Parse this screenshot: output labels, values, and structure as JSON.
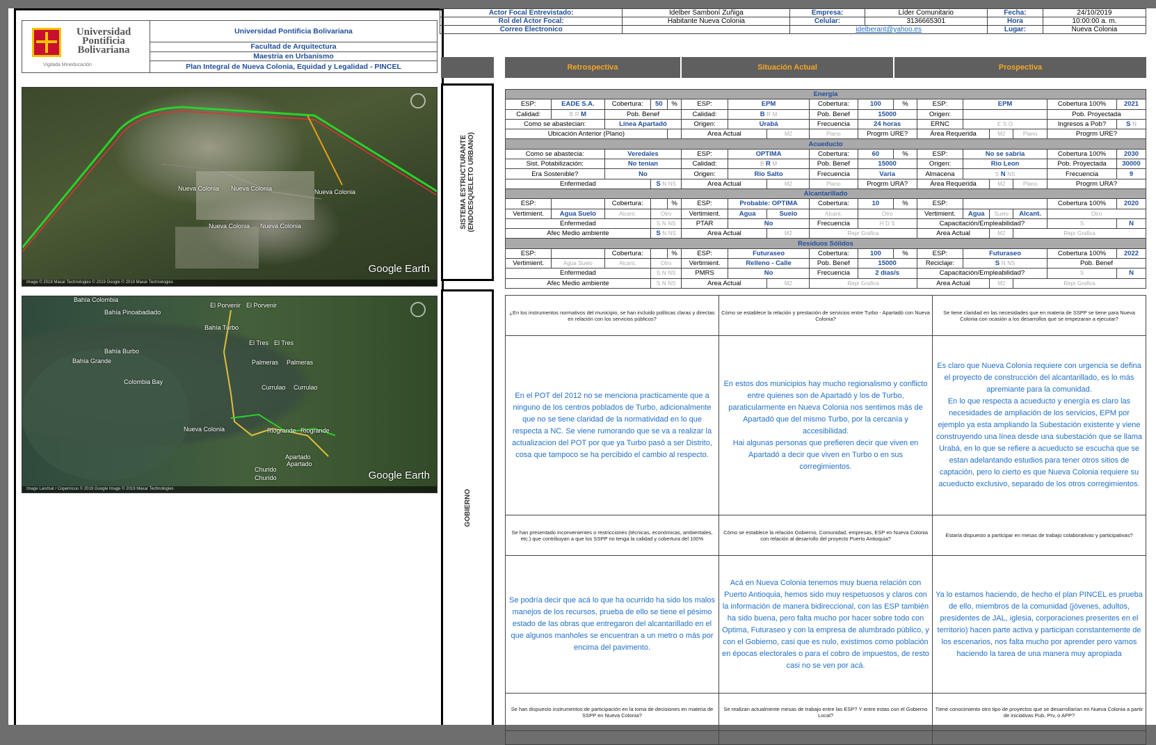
{
  "university": {
    "name": "Universidad Pontificia Bolivariana",
    "logo_text": "Universidad Pontificia Bolivariana",
    "motto": "Vigilada Mineducación",
    "faculty": "Facultad de Arquitectura",
    "program": "Maestría en Urbanismo",
    "plan": "Plan Integral de Nueva Colonia, Equidad y Legalidad - PINCEL"
  },
  "map1": {
    "labels": [
      "Nueva Colonia",
      "Nueva Colonia",
      "Nueva Colonia",
      "Nueva Colonia",
      "Nueva Colonia"
    ],
    "brand": "Google Earth",
    "footer": "Image © 2019 Maxar Technologies  © 2019 Google  © 2019 Maxar Technologies"
  },
  "map2": {
    "labels": [
      "Bahía Colombia",
      "Bahía Pinoabadiado",
      "El Porvenir",
      "El Porvenir",
      "Bahía Turbo",
      "El Tres",
      "El Tres",
      "Bahía Burbo",
      "Bahía Grande",
      "Palmeras",
      "Palmeras",
      "Colombia Bay",
      "Currulao",
      "Currulao",
      "Nueva Colonia",
      "Riogrande",
      "Riogrande",
      "Apartado",
      "Apartado",
      "Churido",
      "Churido"
    ],
    "brand": "Google Earth",
    "footer": "Image Landsat / Copernicus  © 2019 Google  Image © 2019 Maxar Technologies"
  },
  "info": {
    "actor_label": "Actor Focal Entrevistado:",
    "actor": "Idelber Samboní Zuñiga",
    "empresa_label": "Empresa:",
    "empresa": "Líder Comunitario",
    "fecha_label": "Fecha:",
    "fecha": "24/10/2019",
    "rol_label": "Rol del Actor Focal:",
    "rol": "Habitante Nueva Colonia",
    "celular_label": "Celular:",
    "celular": "3136665301",
    "hora_label": "Hora",
    "hora": "10:00:00 a. m.",
    "correo_label": "Correo Electronico",
    "correo": "idelberant@yahoo.es",
    "lugar_label": "Lugar:",
    "lugar": "Nueva Colonia"
  },
  "columns": {
    "retro": "Retrospectiva",
    "actual": "Situación Actual",
    "prosp": "Prospectiva"
  },
  "sides": {
    "sistema": "SISTEMA ESTRUCTURANTE\n(ENDOESQUELETO URBANO)",
    "gobierno": "GOBIERNO"
  },
  "grid": {
    "energia": "Energía",
    "acueducto": "Acueducto",
    "alcantarillado": "Alcantarillado",
    "residuos": "Residuos Sólidos",
    "esp": "ESP:",
    "cobertura": "Cobertura:",
    "pct": "%",
    "calidad": "Calidad:",
    "pob_benef": "Pob. Benef",
    "origen": "Origen:",
    "pob_proy": "Pob. Proyectada",
    "frecuencia": "Frecuencia",
    "area_actual": "Area Actual",
    "area_req": "Área Requerida",
    "m2": "M2",
    "plano": "Plano",
    "repr": "Repr Grafica",
    "progrm_ure": "Progrm URE?",
    "progrm_ura": "Progrm URA?",
    "enfermedad": "Enfermedad",
    "afec": "Afec Medio ambiente",
    "vertim": "Vertimient.",
    "agua": "Agua",
    "suelo": "Suelo",
    "alcant": "Alcant.",
    "otro": "Otro",
    "s": "S",
    "n": "N",
    "ns": "NS",
    "b": "B",
    "r": "R",
    "m": "M",
    "h": "H",
    "d": "D",
    "e1": {
      "esp": "EADE S.A.",
      "cob": "50",
      "como": "Como se abastecian:",
      "como_val": "Línea Apartadó",
      "ubic": "Ubicación Anterior (Plano)",
      "esp2": "EPM",
      "cob2": "100",
      "origen2": "Urabá",
      "pob2": "15000",
      "frec2": "24 horas",
      "esp3": "EPM",
      "cob3": "Cobertura 100%",
      "year3": "2021",
      "ernc": "ERNC",
      "e": "E",
      "o": "O",
      "ingresos": "Ingresos a Pob?"
    },
    "a1": {
      "como": "Como se abastecia:",
      "como_val": "Veredales",
      "sist": "Sist. Potabilización:",
      "sist_val": "No tenian",
      "sost": "Era Sostenible?",
      "sost_val": "No",
      "esp2": "OPTIMA",
      "cob2": "60",
      "origen2": "Rio Salto",
      "pob2": "15000",
      "frec2": "Varia",
      "esp3": "No se sabria",
      "cob3": "Cobertura 100%",
      "year3": "2030",
      "origen3": "Rio Leon",
      "pob3": "30000",
      "almacena": "Almacena",
      "frec3": "9"
    },
    "al1": {
      "esp2": "Probable: OPTIMA",
      "cob2": "10",
      "ptar": "PTAR",
      "ptar_val": "No",
      "cob3": "Cobertura 100%",
      "year3": "2020",
      "capac": "Capacitación/Empleabilidad?"
    },
    "r1": {
      "esp2": "Futuraseo",
      "cob2": "100",
      "relleno": "Relleno - Calle",
      "pob2": "15000",
      "pmrs": "PMRS",
      "pmrs_val": "No",
      "frec2": "2 días/s",
      "esp3": "Futuraseo",
      "cob3": "Cobertura 100%",
      "year3": "2022",
      "reciclaje": "Reciclaje:"
    }
  },
  "gobierno": {
    "q1": [
      "¿En los instrumentos normativos del municipio, se han incluido políticas claras y directas en relación con los servicios públicos?",
      "Cómo se establece la relación y prestación de servicios entre Turbo - Apartadó con Nueva Colonia?",
      "Se tiene claridad en las necesidades que en materia de SSPP se tiene para Nueva Colonia con ocasión a los desarrollos que se empezaran a ejecutar?"
    ],
    "a1": [
      "En el POT del 2012 no se menciona practicamente que a ninguno de los centros poblados de Turbo, adicionalmente que no se tiene claridad de la normatividad en lo que respecta a NC. Se viene rumorando que se va a realizar la actualizacion del POT por que ya Turbo pasó a ser Distrito, cosa que tampoco se ha percibido el cambio al respecto.",
      "En estos dos municipios hay mucho regionalismo y conflicto entre quienes son de Apartadó y los de Turbo, paraticularmente en Nueva Colonia nos sentimos más de Apartadó que del mismo Turbo, por la cercanía y accesibilidad.\nHai algunas personas que prefieren decir que viven en Apartadó a decir que viven en Turbo o en sus corregimientos.",
      "Es claro que Nueva Colonia requiere con urgencia se defina el proyecto de construcción del alcantarillado, es lo más apremiante para la comunidad.\nEn lo que respecta a acueducto y energía es claro las necesidades de ampliación de los servicios, EPM por ejemplo ya esta ampliando la Subestación existente y viene construyendo una línea desde una subestación que se llama Urabá, en lo que se refiere a acueducto se escucha que se estan adelantando estudios para tener otros sitios de captación, pero lo cierto es que Nueva Colonia requiere su acueducto exclusivo, separado de los otros corregimientos."
    ],
    "q2": [
      "Se han presentado inconvenientes o restricciones (técnicas, económicas, ambientales, etc.) que contribuyan a que los SSPP no tenga la calidad y cobertura del 100%",
      "Cómo se establece la relación Gobierno, Comunidad, empresas, ESP en Nueva Colonia con relación al desarrollo del proyecto Puerto Antioquia?",
      "Estaría dispuesto a participar en mesas de trabajo colaborativas y participativas?"
    ],
    "a2": [
      "Se podría decir que acá lo que ha ocurrido ha sido los malos manejos de los recursos, prueba de ello se tiene el pésimo estado de las obras que entregaron del alcantarillado en el que algunos manholes se encuentran a un metro o más por encima del pavimento.",
      "Acá en Nueva Colonia tenemos muy buena relación con Puerto Antioquia, hemos sido muy respetuosos y claros con la información de manera bidireccional, con las ESP también ha sido buena, pero falta mucho por hacer sobre todo con Optima, Futuraseo y con la empresa de alumbrado público, y con el Gobierno, casi que es nulo, existimos como población en épocas electorales o para el cobro de impuestos, de resto casi no se ven por acá.",
      "Ya lo estamos haciendo, de hecho el plan PINCEL es prueba de ello, miembros de la comunidad (jóvenes, adultos, presidentes de JAL, iglesia, corporaciones presentes en el territorio) hacen parte activa y participan constantemente de los escenarios, nos falta mucho por aprender pero vamos haciendo la tarea de una manera muy apropiada"
    ],
    "q3": [
      "Se han dispuesto instrumentos de participación en la toma de decisiones en materia de SSPP en Nueva Colonia?",
      "Se realizan actualmente mesas de trabajo entre las ESP? Y entre estas con el Gobierno Local?",
      "Tiene conocimiento otro tipo de proyectos que se desarrollarían en Nueva Colonia a partir de iniciativas Pub, Prv, o APP?"
    ]
  }
}
